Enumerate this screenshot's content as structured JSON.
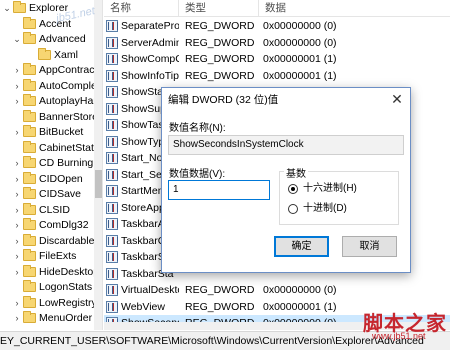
{
  "tree": {
    "items": [
      {
        "label": "Explorer",
        "indent": 0,
        "chevron": "expanded"
      },
      {
        "label": "Accent",
        "indent": 1,
        "chevron": "none"
      },
      {
        "label": "Advanced",
        "indent": 1,
        "chevron": "expanded"
      },
      {
        "label": "Xaml",
        "indent": 2,
        "chevron": "none"
      },
      {
        "label": "AppContract",
        "indent": 1,
        "chevron": "collapsed"
      },
      {
        "label": "AutoComplete",
        "indent": 1,
        "chevron": "collapsed"
      },
      {
        "label": "AutoplayHand",
        "indent": 1,
        "chevron": "collapsed"
      },
      {
        "label": "BannerStore",
        "indent": 1,
        "chevron": "none"
      },
      {
        "label": "BitBucket",
        "indent": 1,
        "chevron": "collapsed"
      },
      {
        "label": "CabinetState",
        "indent": 1,
        "chevron": "none"
      },
      {
        "label": "CD Burning",
        "indent": 1,
        "chevron": "collapsed"
      },
      {
        "label": "CIDOpen",
        "indent": 1,
        "chevron": "collapsed"
      },
      {
        "label": "CIDSave",
        "indent": 1,
        "chevron": "collapsed"
      },
      {
        "label": "CLSID",
        "indent": 1,
        "chevron": "collapsed"
      },
      {
        "label": "ComDlg32",
        "indent": 1,
        "chevron": "collapsed"
      },
      {
        "label": "Discardable",
        "indent": 1,
        "chevron": "collapsed"
      },
      {
        "label": "FileExts",
        "indent": 1,
        "chevron": "collapsed"
      },
      {
        "label": "HideDesktopI",
        "indent": 1,
        "chevron": "collapsed"
      },
      {
        "label": "LogonStats",
        "indent": 1,
        "chevron": "none"
      },
      {
        "label": "LowRegistry",
        "indent": 1,
        "chevron": "collapsed"
      },
      {
        "label": "MenuOrder",
        "indent": 1,
        "chevron": "collapsed"
      }
    ]
  },
  "values": {
    "headers": {
      "name": "名称",
      "type": "类型",
      "data": "数据"
    },
    "rows": [
      {
        "name": "SeparateProce...",
        "type": "REG_DWORD",
        "data": "0x00000000 (0)",
        "selected": false
      },
      {
        "name": "ServerAdminUI",
        "type": "REG_DWORD",
        "data": "0x00000000 (0)",
        "selected": false
      },
      {
        "name": "ShowCompCol...",
        "type": "REG_DWORD",
        "data": "0x00000001 (1)",
        "selected": false
      },
      {
        "name": "ShowInfoTip",
        "type": "REG_DWORD",
        "data": "0x00000001 (1)",
        "selected": false
      },
      {
        "name": "ShowStatus",
        "type": "",
        "data": "",
        "selected": false
      },
      {
        "name": "ShowSuper",
        "type": "",
        "data": "",
        "selected": false
      },
      {
        "name": "ShowTask",
        "type": "",
        "data": "",
        "selected": false
      },
      {
        "name": "ShowType",
        "type": "",
        "data": "",
        "selected": false
      },
      {
        "name": "Start_Notif",
        "type": "",
        "data": "",
        "selected": false
      },
      {
        "name": "Start_Sear",
        "type": "",
        "data": "",
        "selected": false
      },
      {
        "name": "StartMenu",
        "type": "",
        "data": "",
        "selected": false
      },
      {
        "name": "StoreApps",
        "type": "",
        "data": "",
        "selected": false
      },
      {
        "name": "TaskbarAn",
        "type": "",
        "data": "",
        "selected": false
      },
      {
        "name": "TaskbarGl",
        "type": "",
        "data": "",
        "selected": false
      },
      {
        "name": "TaskbarSiz",
        "type": "",
        "data": "",
        "selected": false
      },
      {
        "name": "TaskbarSta",
        "type": "",
        "data": "",
        "selected": false
      },
      {
        "name": "VirtualDeskto...",
        "type": "REG_DWORD",
        "data": "0x00000000 (0)",
        "selected": false
      },
      {
        "name": "WebView",
        "type": "REG_DWORD",
        "data": "0x00000001 (1)",
        "selected": false
      },
      {
        "name": "ShowSecondsI...",
        "type": "REG_DWORD",
        "data": "0x00000000 (0)",
        "selected": true
      }
    ]
  },
  "statusbar": {
    "path": "EY_CURRENT_USER\\SOFTWARE\\Microsoft\\Windows\\CurrentVersion\\Explorer\\Advanced"
  },
  "dialog": {
    "title": "编辑 DWORD (32 位)值",
    "close_glyph": "✕",
    "name_label": "数值名称(N):",
    "name_value": "ShowSecondsInSystemClock",
    "data_label": "数值数据(V):",
    "data_value": "1",
    "base_label": "基数",
    "hex_label": "十六进制(H)",
    "dec_label": "十进制(D)",
    "selected_base": "hex",
    "ok_label": "确定",
    "cancel_label": "取消"
  },
  "watermark": {
    "top": "jb51.net",
    "logo": "脚本之家",
    "url": "www.jb51.net"
  },
  "colors": {
    "selection": "#cce8ff",
    "accent": "#0078d7",
    "folder": "#f7d672",
    "watermark": "#c6262e"
  },
  "icons": {
    "tree_item": "folder-icon",
    "value_item": "reg-dword-icon",
    "expanded": "chevron-down-icon",
    "collapsed": "chevron-right-icon"
  }
}
